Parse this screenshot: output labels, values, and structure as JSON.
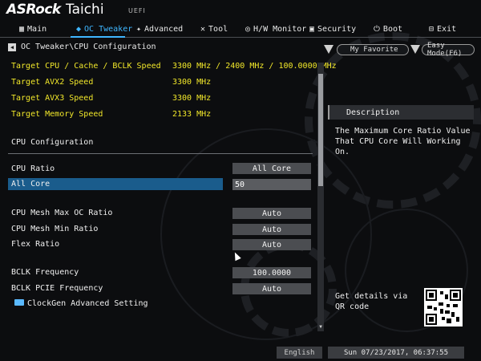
{
  "header": {
    "brand": "ASRock",
    "model": "Taichi",
    "badge": "UEFI"
  },
  "nav": {
    "tabs": [
      {
        "label": "Main",
        "icon": "grid-icon"
      },
      {
        "label": "OC Tweaker",
        "icon": "drop-icon"
      },
      {
        "label": "Advanced",
        "icon": "star-icon"
      },
      {
        "label": "Tool",
        "icon": "wrench-icon"
      },
      {
        "label": "H/W Monitor",
        "icon": "monitor-icon"
      },
      {
        "label": "Security",
        "icon": "shield-icon"
      },
      {
        "label": "Boot",
        "icon": "power-icon"
      },
      {
        "label": "Exit",
        "icon": "exit-icon"
      }
    ],
    "active": "OC Tweaker",
    "accent": "#3fb6ff"
  },
  "breadcrumb": "OC Tweaker\\CPU Configuration",
  "favorite_label": "My Favorite",
  "easy_mode_label": "Easy Mode(F6)",
  "info_rows": [
    {
      "label": "Target CPU / Cache / BCLK Speed",
      "value": "3300 MHz / 2400 MHz / 100.0000 MHz"
    },
    {
      "label": "Target AVX2 Speed",
      "value": "3300 MHz"
    },
    {
      "label": "Target AVX3 Speed",
      "value": "3300 MHz"
    },
    {
      "label": "Target Memory Speed",
      "value": "2133 MHz"
    }
  ],
  "section_title": "CPU Configuration",
  "settings": {
    "cpu_ratio": {
      "label": "CPU Ratio",
      "value": "All Core"
    },
    "all_core": {
      "label": "All Core",
      "value": "50"
    },
    "mesh_max": {
      "label": "CPU Mesh Max OC Ratio",
      "value": "Auto"
    },
    "mesh_min": {
      "label": "CPU Mesh Min Ratio",
      "value": "Auto"
    },
    "flex_ratio": {
      "label": "Flex Ratio",
      "value": "Auto"
    },
    "bclk_freq": {
      "label": "BCLK Frequency",
      "value": "100.0000"
    },
    "bclk_pcie": {
      "label": "BCLK PCIE Frequency",
      "value": "Auto"
    },
    "clockgen": {
      "label": "ClockGen Advanced Setting"
    }
  },
  "description": {
    "title": "Description",
    "text": "The Maximum Core Ratio Value That CPU Core Will Working On.",
    "qr_text": "Get details via QR code"
  },
  "footer": {
    "language": "English",
    "datetime": "Sun 07/23/2017, 06:37:55"
  },
  "colors": {
    "value_yellow": "#f1e72a",
    "selected_blue": "#1a5c8c"
  }
}
